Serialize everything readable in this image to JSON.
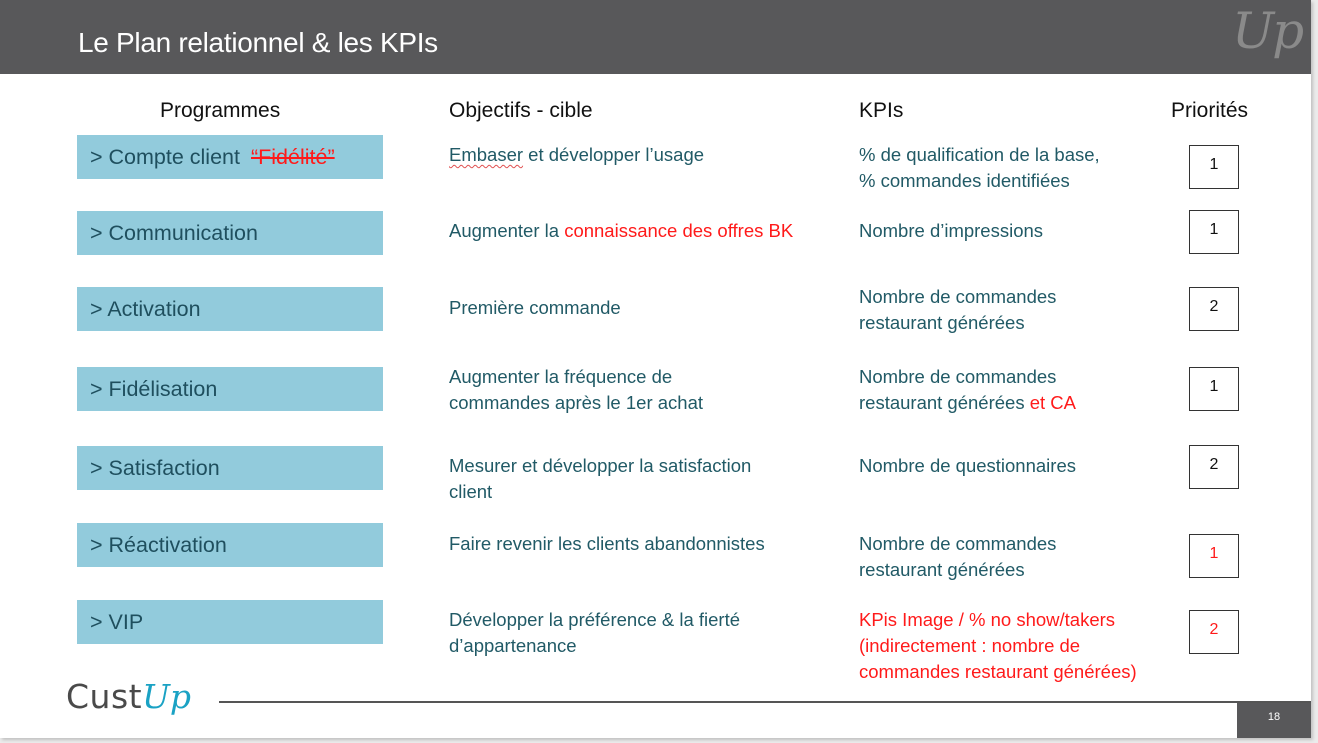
{
  "header": {
    "title": "Le Plan relationnel & les KPIs",
    "watermark": "Up"
  },
  "columns": {
    "programmes": "Programmes",
    "objectifs": "Objectifs - cible",
    "kpis": "KPIs",
    "priorites": "Priorités"
  },
  "rows": [
    {
      "programme": "> Compte client",
      "programme_struck": "“Fidélité”",
      "objectif": [
        {
          "text": "Embaser",
          "style": "squiggle"
        },
        {
          "text": " et développer l’usage",
          "style": "normal"
        }
      ],
      "kpi_lines": [
        [
          {
            "text": "% de qualification de la base,",
            "style": "normal"
          }
        ],
        [
          {
            "text": "% commandes identifiées",
            "style": "normal"
          }
        ]
      ],
      "priority": "1",
      "priority_color": "black"
    },
    {
      "programme": "> Communication",
      "objectif": [
        {
          "text": "Augmenter la ",
          "style": "normal"
        },
        {
          "text": "connaissance des offres BK",
          "style": "red"
        }
      ],
      "kpi_lines": [
        [
          {
            "text": "Nombre d’impressions",
            "style": "normal"
          }
        ]
      ],
      "priority": "1",
      "priority_color": "black"
    },
    {
      "programme": "> Activation",
      "objectif": [
        {
          "text": "Première commande",
          "style": "normal"
        }
      ],
      "kpi_lines": [
        [
          {
            "text": "Nombre de commandes",
            "style": "normal"
          }
        ],
        [
          {
            "text": "restaurant générées",
            "style": "normal"
          }
        ]
      ],
      "priority": "2",
      "priority_color": "black"
    },
    {
      "programme": "> Fidélisation",
      "objectif_lines": [
        "Augmenter la fréquence de",
        "commandes après le 1er achat"
      ],
      "kpi_lines": [
        [
          {
            "text": "Nombre de commandes",
            "style": "normal"
          }
        ],
        [
          {
            "text": "restaurant générées ",
            "style": "normal"
          },
          {
            "text": "et CA",
            "style": "red"
          }
        ]
      ],
      "priority": "1",
      "priority_color": "black"
    },
    {
      "programme": "> Satisfaction",
      "objectif_lines": [
        "Mesurer et développer la satisfaction",
        "client"
      ],
      "kpi_lines": [
        [
          {
            "text": "Nombre de questionnaires",
            "style": "normal"
          }
        ]
      ],
      "priority": "2",
      "priority_color": "black"
    },
    {
      "programme": "> Réactivation",
      "objectif": [
        {
          "text": "Faire revenir les clients abandonnistes",
          "style": "normal"
        }
      ],
      "kpi_lines": [
        [
          {
            "text": "Nombre de commandes",
            "style": "normal"
          }
        ],
        [
          {
            "text": "restaurant générées",
            "style": "normal"
          }
        ]
      ],
      "priority": "1",
      "priority_color": "red"
    },
    {
      "programme": "> VIP",
      "objectif_lines": [
        "Développer la préférence & la fierté",
        "d’appartenance"
      ],
      "kpi_lines": [
        [
          {
            "text": "KPis Image / % no show/takers",
            "style": "red"
          }
        ],
        [
          {
            "text": "(indirectement : nombre de",
            "style": "red"
          }
        ],
        [
          {
            "text": "commandes restaurant générées)",
            "style": "red"
          }
        ]
      ],
      "priority": "2",
      "priority_color": "red"
    }
  ],
  "footer": {
    "logo_cust": "Cust",
    "logo_up": "Up",
    "page_number": "18"
  },
  "colors": {
    "title_bar": "#58585a",
    "programme_box": "#92cbdc",
    "body_text": "#215a66",
    "highlight_red": "#ff1a1a",
    "logo_accent": "#1aa2c4"
  }
}
